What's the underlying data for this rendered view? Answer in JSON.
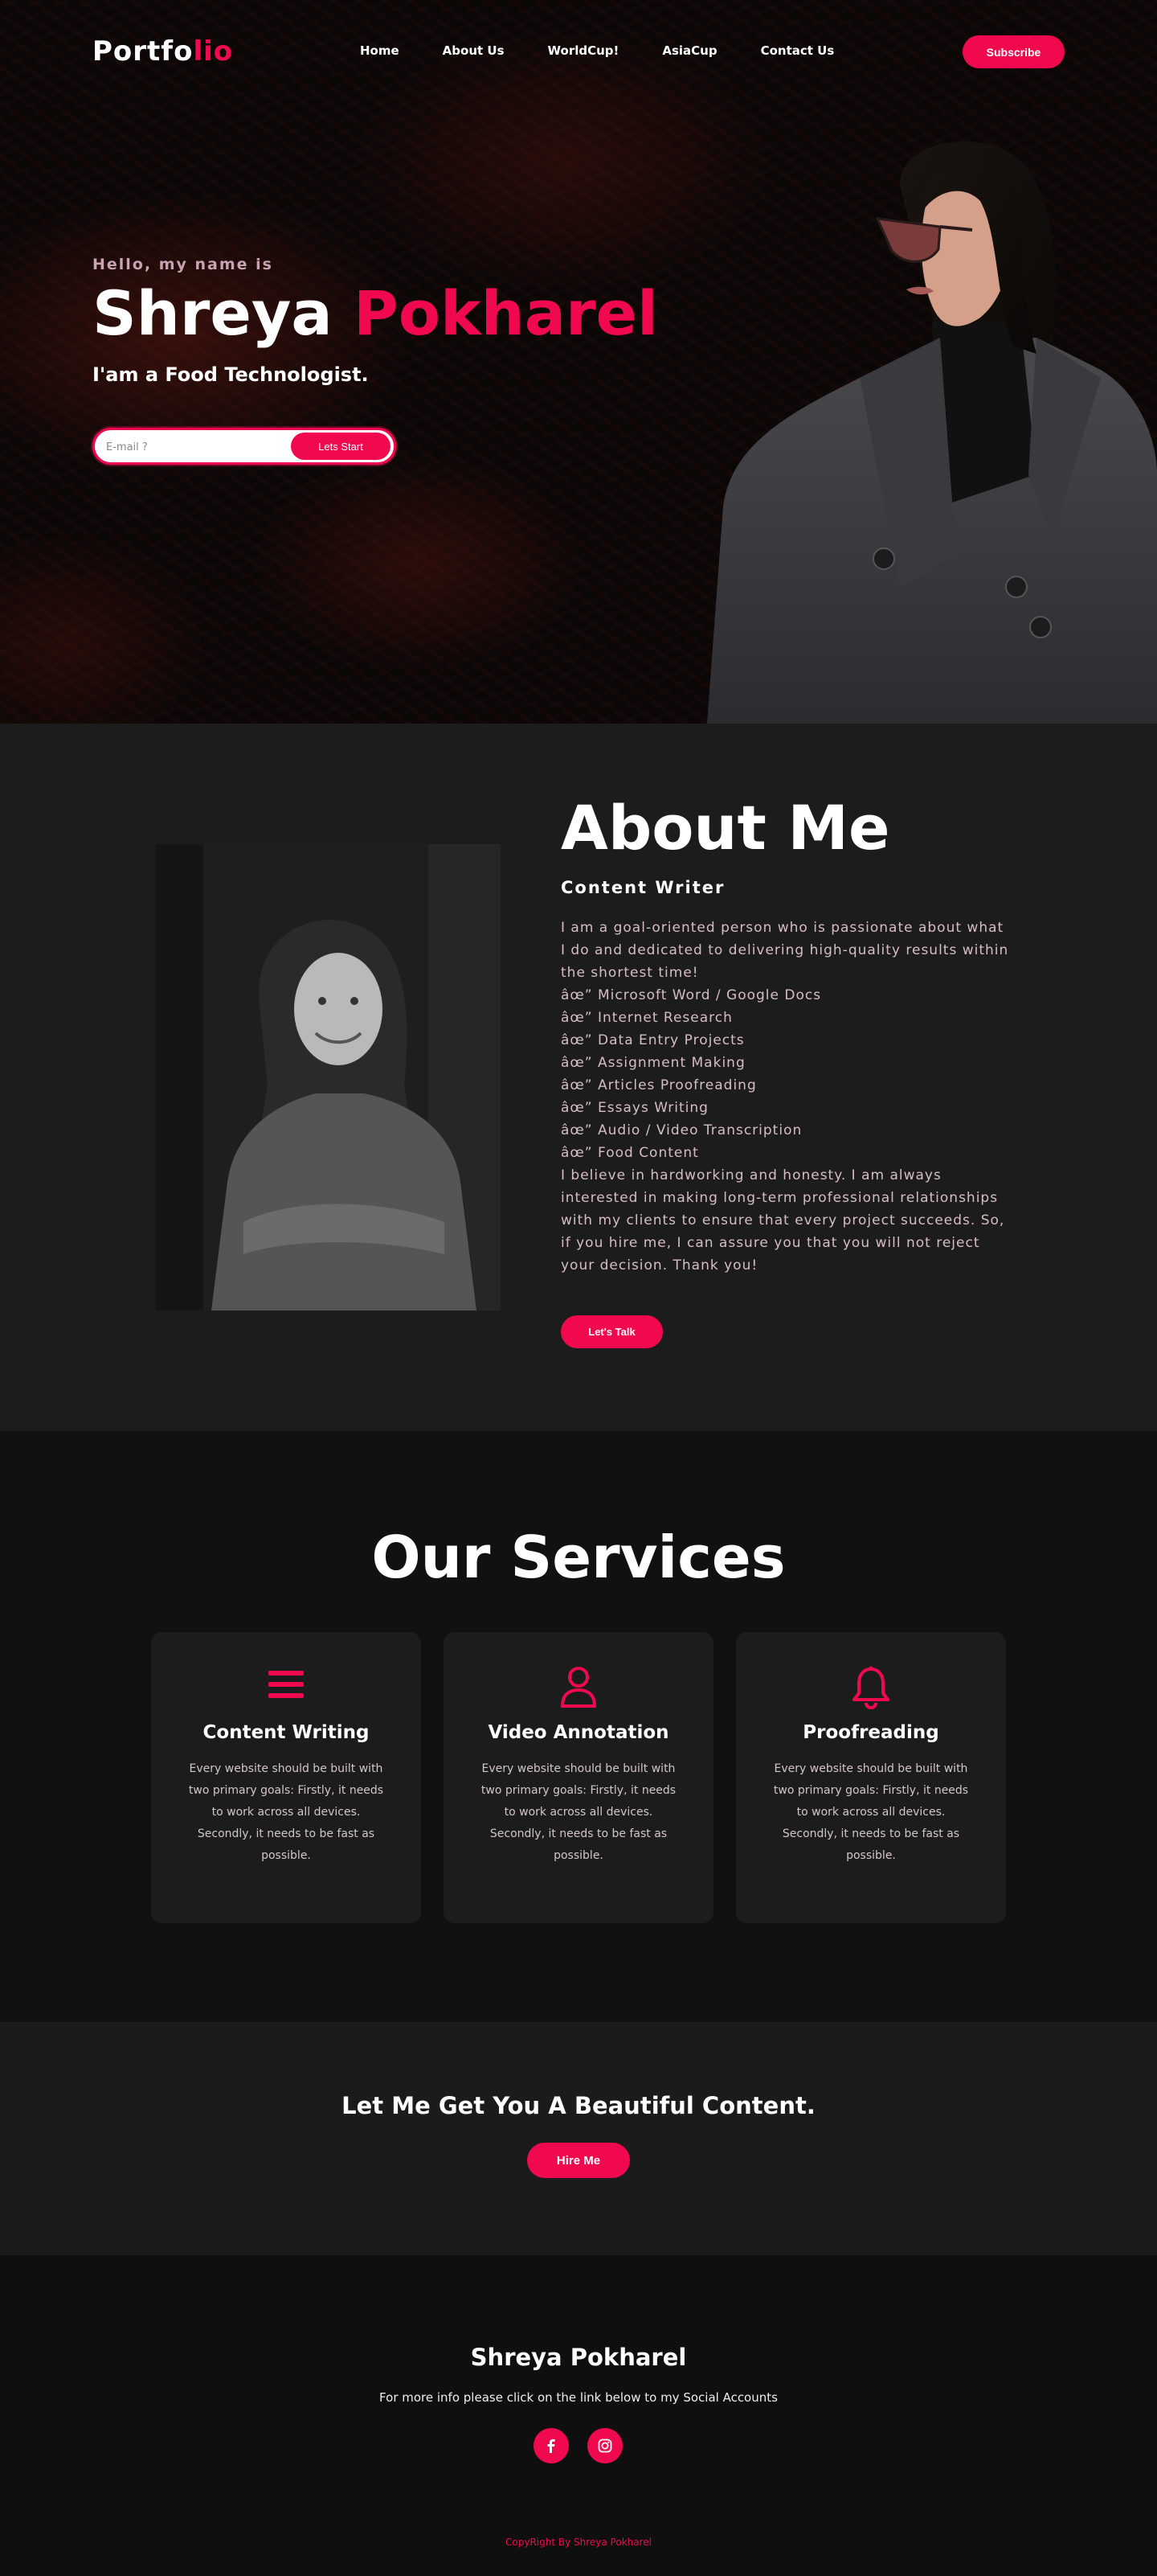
{
  "brand": {
    "logo_main": "Portfo",
    "logo_accent": "lio",
    "accent_color": "#f0094f"
  },
  "nav": {
    "items": [
      {
        "label": "Home"
      },
      {
        "label": "About Us"
      },
      {
        "label": "WorldCup!"
      },
      {
        "label": "AsiaCup"
      },
      {
        "label": "Contact Us"
      }
    ],
    "subscribe_label": "Subscribe"
  },
  "hero": {
    "greeting": "Hello, my name is",
    "first_name": "Shreya",
    "last_name": "Pokharel",
    "tagline": "I'am a Food Technologist.",
    "email_placeholder": "E-mail ?",
    "start_label": "Lets Start"
  },
  "about": {
    "title": "About Me",
    "subtitle": "Content Writer",
    "intro": "I am a goal-oriented person who is passionate about what I do and dedicated to delivering high-quality results within the shortest time!",
    "skills": [
      "âœ” Microsoft Word / Google Docs",
      "âœ” Internet Research",
      "âœ” Data Entry Projects",
      "âœ” Assignment Making",
      "âœ” Articles Proofreading",
      "âœ” Essays Writing",
      "âœ” Audio / Video Transcription",
      "âœ” Food Content"
    ],
    "closing": "I believe in hardworking and honesty. I am always interested in making long-term professional relationships with my clients to ensure that every project succeeds. So, if you hire me, I can assure you that you will not reject your decision. Thank you!",
    "button_label": "Let's Talk"
  },
  "services": {
    "title": "Our Services",
    "cards": [
      {
        "icon": "menu-lines-icon",
        "title": "Content Writing",
        "text": "Every website should be built with two primary goals: Firstly, it needs to work across all devices. Secondly, it needs to be fast as possible."
      },
      {
        "icon": "user-icon",
        "title": "Video Annotation",
        "text": "Every website should be built with two primary goals: Firstly, it needs to work across all devices. Secondly, it needs to be fast as possible."
      },
      {
        "icon": "bell-icon",
        "title": "Proofreading",
        "text": "Every website should be built with two primary goals: Firstly, it needs to work across all devices. Secondly, it needs to be fast as possible."
      }
    ]
  },
  "cta": {
    "heading": "Let Me Get You A Beautiful Content.",
    "button_label": "Hire Me"
  },
  "footer": {
    "name": "Shreya Pokharel",
    "info": "For more info please click on the link below to my Social Accounts",
    "socials": [
      {
        "icon": "facebook-icon"
      },
      {
        "icon": "instagram-icon"
      }
    ],
    "copyright": "CopyRight By Shreya Pokharel"
  }
}
